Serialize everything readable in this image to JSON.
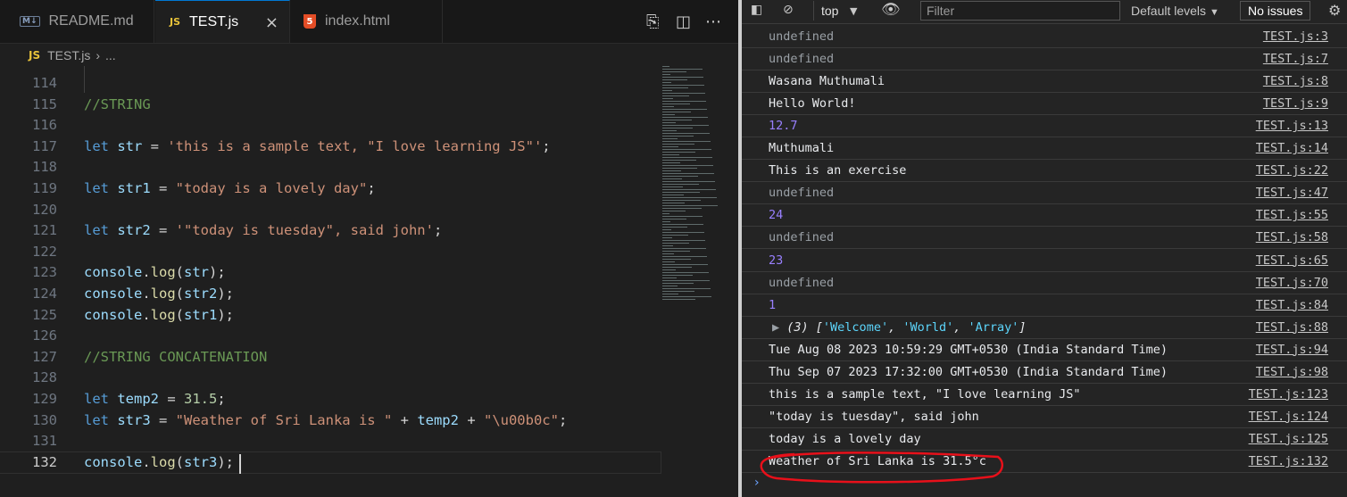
{
  "editor": {
    "tabs": [
      {
        "icon": "M↓",
        "label": "README.md"
      },
      {
        "icon": "JS",
        "label": "TEST.js",
        "close": "×"
      },
      {
        "icon": "5",
        "label": "index.html"
      }
    ],
    "breadcrumb": {
      "icon": "JS",
      "file": "TEST.js",
      "sep": "›",
      "rest": "..."
    },
    "lines": [
      {
        "n": "114"
      },
      {
        "n": "115",
        "comment": "//STRING"
      },
      {
        "n": "116"
      },
      {
        "n": "117",
        "kw": "let",
        "var": "str",
        "str": "'this is a sample text, \"I love learning JS\"'"
      },
      {
        "n": "118"
      },
      {
        "n": "119",
        "kw": "let",
        "var": "str1",
        "str": "\"today is a lovely day\""
      },
      {
        "n": "120"
      },
      {
        "n": "121",
        "kw": "let",
        "var": "str2",
        "str": "'\"today is tuesday\", said john'"
      },
      {
        "n": "122"
      },
      {
        "n": "123",
        "obj": "console",
        "fn": "log",
        "arg": "str"
      },
      {
        "n": "124",
        "obj": "console",
        "fn": "log",
        "arg": "str2"
      },
      {
        "n": "125",
        "obj": "console",
        "fn": "log",
        "arg": "str1"
      },
      {
        "n": "126"
      },
      {
        "n": "127",
        "comment": "//STRING CONCATENATION"
      },
      {
        "n": "128"
      },
      {
        "n": "129",
        "kw": "let",
        "var": "temp2",
        "num": "31.5"
      },
      {
        "n": "130",
        "kw": "let",
        "var": "str3",
        "s1": "\"Weather of Sri Lanka is \"",
        "v2": "temp2",
        "s2": "\"\\u00b0c\""
      },
      {
        "n": "131"
      },
      {
        "n": "132",
        "obj": "console",
        "fn": "log",
        "arg": "str3"
      }
    ]
  },
  "console": {
    "toolbar": {
      "context": "top",
      "filter_placeholder": "Filter",
      "levels": "Default levels",
      "issues": "No issues"
    },
    "messages": [
      {
        "text": "undefined",
        "src": "TEST.js:3",
        "kind": "gray"
      },
      {
        "text": "undefined",
        "src": "TEST.js:7",
        "kind": "gray"
      },
      {
        "text": "Wasana Muthumali",
        "src": "TEST.js:8",
        "kind": "white"
      },
      {
        "text": "Hello World!",
        "src": "TEST.js:9",
        "kind": "white"
      },
      {
        "text": "12.7",
        "src": "TEST.js:13",
        "kind": "num"
      },
      {
        "text": "Muthumali",
        "src": "TEST.js:14",
        "kind": "white"
      },
      {
        "text": "This is an exercise",
        "src": "TEST.js:22",
        "kind": "white"
      },
      {
        "text": "undefined",
        "src": "TEST.js:47",
        "kind": "gray"
      },
      {
        "text": "24",
        "src": "TEST.js:55",
        "kind": "num"
      },
      {
        "text": "undefined",
        "src": "TEST.js:58",
        "kind": "gray"
      },
      {
        "text": "23",
        "src": "TEST.js:65",
        "kind": "num"
      },
      {
        "text": "undefined",
        "src": "TEST.js:70",
        "kind": "gray"
      },
      {
        "text": "1",
        "src": "TEST.js:84",
        "kind": "num"
      },
      {
        "text": "(3) ['Welcome', 'World', 'Array']",
        "src": "TEST.js:88",
        "kind": "array"
      },
      {
        "text": "Tue Aug 08 2023 10:59:29 GMT+0530 (India Standard Time)",
        "src": "TEST.js:94",
        "kind": "white"
      },
      {
        "text": "Thu Sep 07 2023 17:32:00 GMT+0530 (India Standard Time)",
        "src": "TEST.js:98",
        "kind": "white"
      },
      {
        "text": "this is a sample text, \"I love learning JS\"",
        "src": "TEST.js:123",
        "kind": "white"
      },
      {
        "text": "\"today is tuesday\", said john",
        "src": "TEST.js:124",
        "kind": "white"
      },
      {
        "text": "today is a lovely day",
        "src": "TEST.js:125",
        "kind": "white"
      },
      {
        "text": "Weather of Sri Lanka is 31.5°c",
        "src": "TEST.js:132",
        "kind": "white"
      }
    ],
    "prompt": "›"
  },
  "colors": {
    "highlight": "#e8101a",
    "accent": "#0078d4"
  }
}
